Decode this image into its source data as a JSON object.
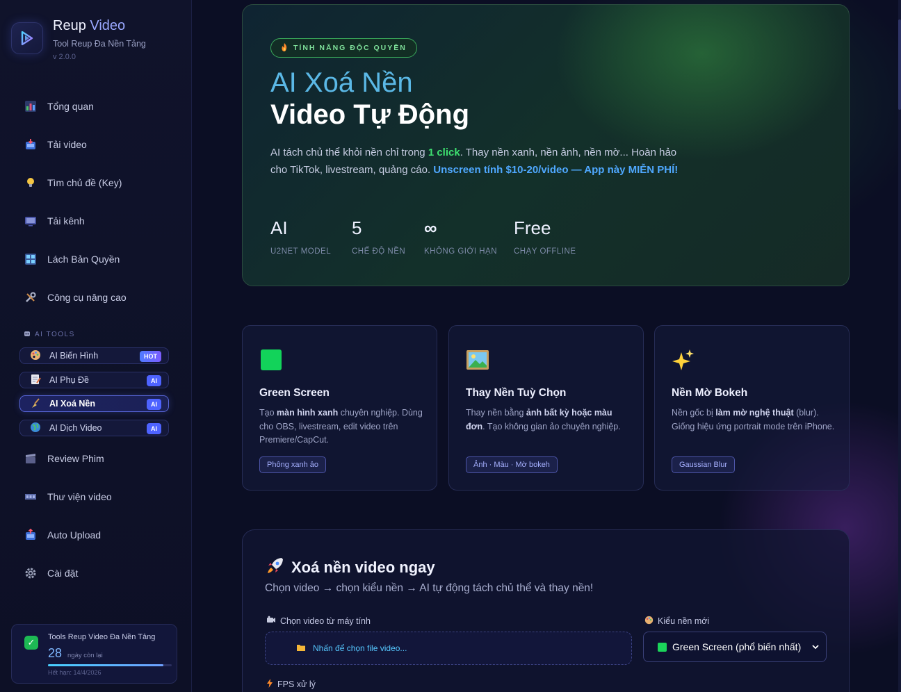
{
  "brand": {
    "name_main": "Reup",
    "name_accent": "Video",
    "subtitle": "Tool Reup Đa Nền Tảng",
    "version": "v 2.0.0"
  },
  "nav": {
    "items": [
      {
        "label": "Tổng quan",
        "icon": "chart-icon"
      },
      {
        "label": "Tải video",
        "icon": "download-box-icon"
      },
      {
        "label": "Tìm chủ đề (Key)",
        "icon": "lightbulb-icon"
      },
      {
        "label": "Tải kênh",
        "icon": "tv-icon"
      },
      {
        "label": "Lách Bản Quyền",
        "icon": "grid-icon"
      },
      {
        "label": "Công cụ nâng cao",
        "icon": "tools-icon"
      }
    ],
    "section_label": "AI TOOLS",
    "ai_items": [
      {
        "label": "AI Biến Hình",
        "badge": "HOT"
      },
      {
        "label": "AI Phụ Đề",
        "badge": "AI"
      },
      {
        "label": "AI Xoá Nền",
        "badge": "AI"
      },
      {
        "label": "AI Dịch Video",
        "badge": "AI"
      }
    ],
    "bottom_items": [
      {
        "label": "Review Phim",
        "icon": "clapper-icon"
      },
      {
        "label": "Thư viện video",
        "icon": "film-strip-icon"
      },
      {
        "label": "Auto Upload",
        "icon": "upload-box-icon"
      },
      {
        "label": "Cài đặt",
        "icon": "gear-icon"
      }
    ]
  },
  "license": {
    "title": "Tools Reup Video Đa Nền Tảng",
    "days": "28",
    "days_label": "ngày còn lại",
    "progress": 0.93,
    "expiry": "Hết hạn: 14/4/2026"
  },
  "hero": {
    "tag": "TÍNH NĂNG ĐỘC QUYỀN",
    "title_line1": "AI Xoá Nền",
    "title_line2": "Video Tự Động",
    "desc_1": "AI tách chủ thể khỏi nền chỉ trong ",
    "desc_highlight": "1 click",
    "desc_2": ". Thay nền xanh, nền ảnh, nền mờ... Hoàn hảo cho TikTok, livestream, quảng cáo. ",
    "desc_link": "Unscreen tính $10-20/video — App này MIỄN PHÍ!",
    "stats": [
      {
        "value": "AI",
        "label": "U2NET MODEL"
      },
      {
        "value": "5",
        "label": "CHẾ ĐỘ NỀN"
      },
      {
        "value": "∞",
        "label": "KHÔNG GIỚI HẠN"
      },
      {
        "value": "Free",
        "label": "CHẠY OFFLINE"
      }
    ]
  },
  "features": [
    {
      "title": "Green Screen",
      "desc_pre": "Tạo ",
      "desc_bold": "màn hình xanh",
      "desc_post": " chuyên nghiệp. Dùng cho OBS, livestream, edit video trên Premiere/CapCut.",
      "tag": "Phông xanh ảo",
      "icon": "green-square-icon"
    },
    {
      "title": "Thay Nền Tuỳ Chọn",
      "desc_pre": "Thay nền bằng ",
      "desc_bold": "ảnh bất kỳ hoặc màu đơn",
      "desc_post": ". Tạo không gian ảo chuyên nghiệp.",
      "tag": "Ảnh · Màu · Mờ bokeh",
      "icon": "landscape-picture-icon"
    },
    {
      "title": "Nền Mờ Bokeh",
      "desc_pre": "Nền gốc bị ",
      "desc_bold": "làm mờ nghệ thuật",
      "desc_post": " (blur). Giống hiệu ứng portrait mode trên iPhone.",
      "tag": "Gaussian Blur",
      "icon": "sparkles-icon"
    }
  ],
  "upload": {
    "title": "Xoá nền video ngay",
    "subtitle": "Chọn video → chọn kiểu nền → AI tự động tách chủ thể và thay nền!",
    "video_label": "Chọn video từ máy tính",
    "dropzone_text": "Nhấn để chọn file video...",
    "bg_label": "Kiểu nền mới",
    "bg_selected": "Green Screen (phổ biến nhất)",
    "fps_label": "FPS xử lý"
  }
}
